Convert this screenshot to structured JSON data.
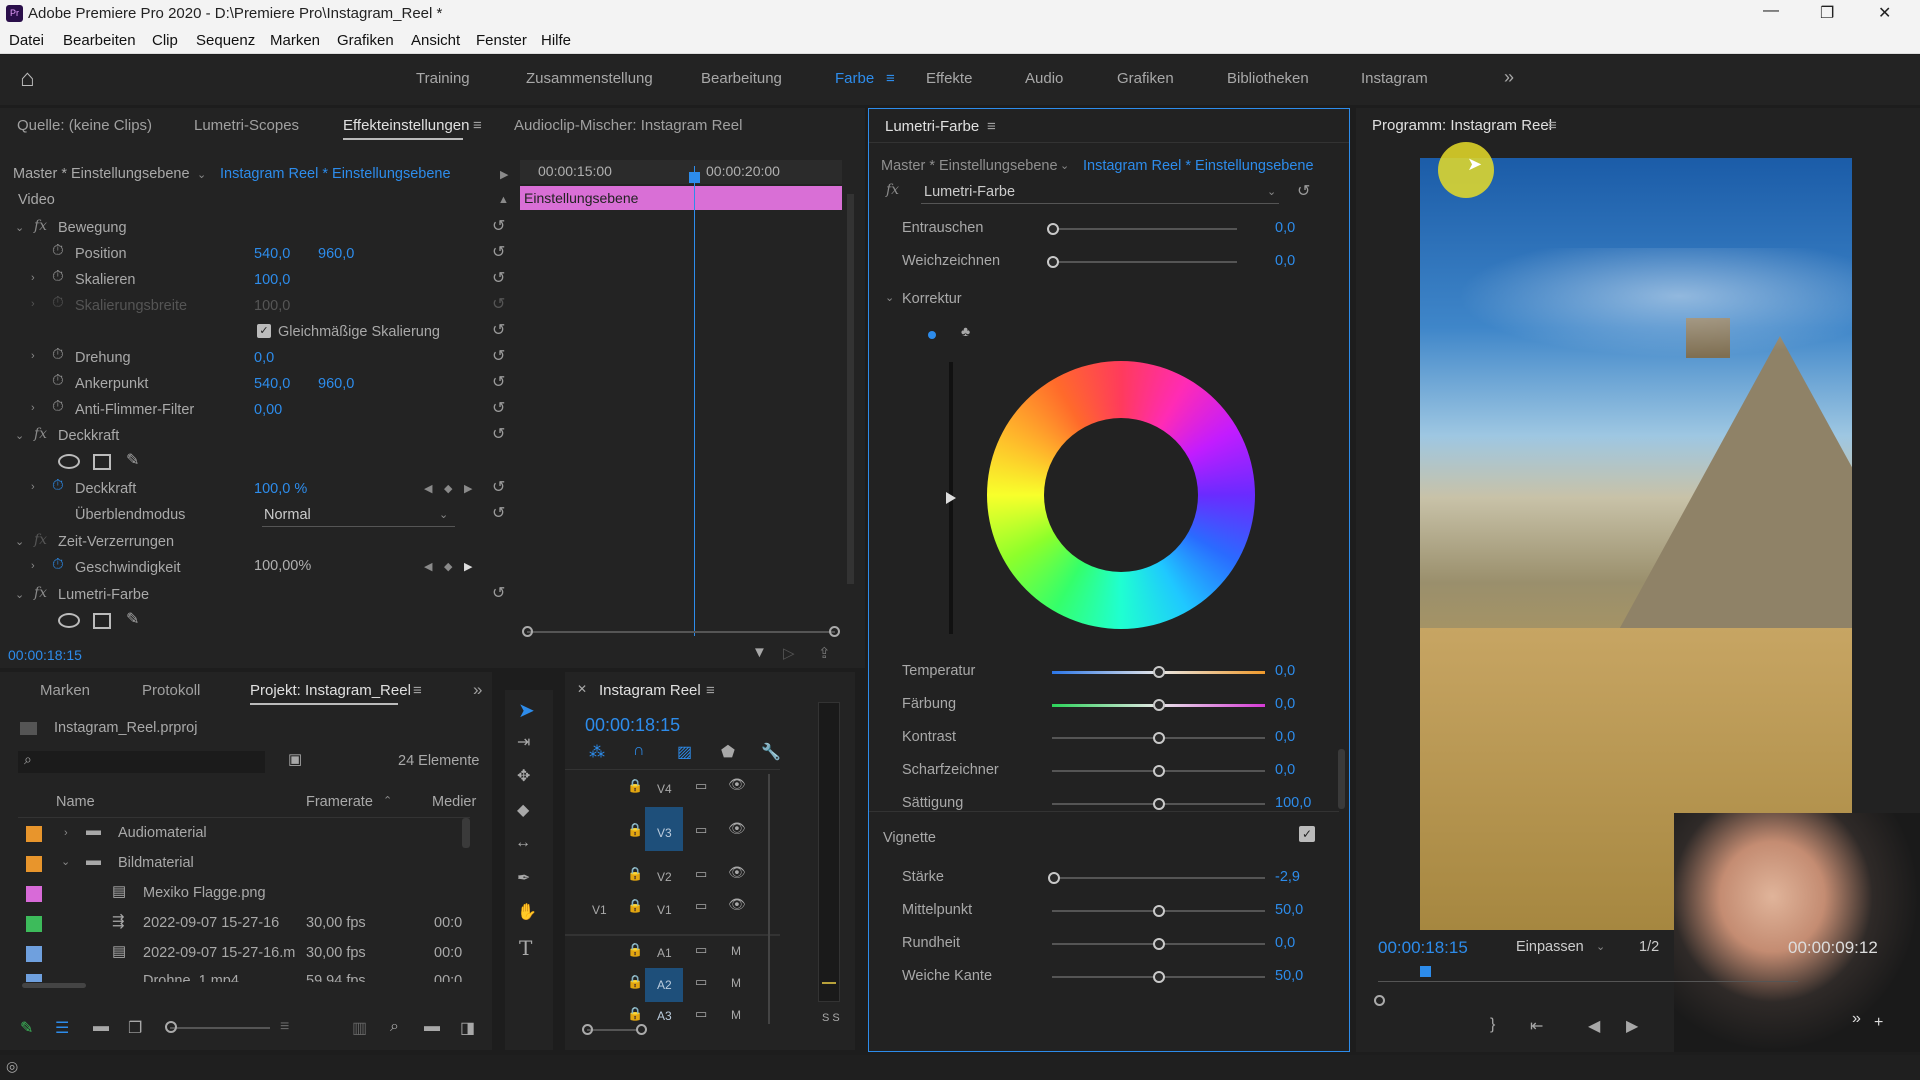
{
  "window": {
    "title": "Adobe Premiere Pro 2020 - D:\\Premiere Pro\\Instagram_Reel *",
    "minimize": "—",
    "maximize": "❐",
    "close": "✕"
  },
  "menu": [
    "Datei",
    "Bearbeiten",
    "Clip",
    "Sequenz",
    "Marken",
    "Grafiken",
    "Ansicht",
    "Fenster",
    "Hilfe"
  ],
  "workspaces": {
    "items": [
      "Training",
      "Zusammenstellung",
      "Bearbeitung",
      "Farbe",
      "Effekte",
      "Audio",
      "Grafiken",
      "Bibliotheken",
      "Instagram"
    ],
    "active": "Farbe",
    "more": "»"
  },
  "left_top": {
    "tabs": [
      "Quelle: (keine Clips)",
      "Lumetri-Scopes",
      "Effekteinstellungen",
      "Audioclip-Mischer: Instagram Reel"
    ],
    "master": "Master * Einstellungsebene",
    "clip": "Instagram Reel * Einstellungsebene",
    "ruler": [
      "00:00:15:00",
      "00:00:20:00"
    ],
    "clip_bar": "Einstellungsebene",
    "section_video": "Video",
    "motion": "Bewegung",
    "position": {
      "label": "Position",
      "x": "540,0",
      "y": "960,0"
    },
    "scale": {
      "label": "Skalieren",
      "value": "100,0"
    },
    "scale_width": {
      "label": "Skalierungsbreite",
      "value": "100,0"
    },
    "uniform": "Gleichmäßige Skalierung",
    "rotation": {
      "label": "Drehung",
      "value": "0,0"
    },
    "anchor": {
      "label": "Ankerpunkt",
      "x": "540,0",
      "y": "960,0"
    },
    "flicker": {
      "label": "Anti-Flimmer-Filter",
      "value": "0,00"
    },
    "opacity_group": "Deckkraft",
    "opacity": {
      "label": "Deckkraft",
      "value": "100,0 %"
    },
    "blend": {
      "label": "Überblendmodus",
      "value": "Normal"
    },
    "time_remap": "Zeit-Verzerrungen",
    "speed": {
      "label": "Geschwindigkeit",
      "value": "100,00%"
    },
    "lumetri": "Lumetri-Farbe",
    "timecode": "00:00:18:15"
  },
  "project": {
    "tabs": [
      "Marken",
      "Protokoll",
      "Projekt: Instagram_Reel"
    ],
    "file": "Instagram_Reel.prproj",
    "count": "24 Elemente",
    "columns": [
      "Name",
      "Framerate",
      "Medier"
    ],
    "rows": [
      {
        "name": "Audiomaterial",
        "fps": "",
        "media": "",
        "color": "#e8952c",
        "type": "folder"
      },
      {
        "name": "Bildmaterial",
        "fps": "",
        "media": "",
        "color": "#e8952c",
        "type": "folder"
      },
      {
        "name": "Mexiko Flagge.png",
        "fps": "",
        "media": "",
        "color": "#d86ad8",
        "type": "image"
      },
      {
        "name": "2022-09-07 15-27-16",
        "fps": "30,00 fps",
        "media": "00:0",
        "color": "#3dbb5b",
        "type": "sequence"
      },
      {
        "name": "2022-09-07 15-27-16.m",
        "fps": "30,00 fps",
        "media": "00:0",
        "color": "#6fa0de",
        "type": "file"
      },
      {
        "name": "Drohne_1.mp4",
        "fps": "59,94 fps",
        "media": "00:0",
        "color": "#6fa0de",
        "type": "file"
      }
    ]
  },
  "timeline": {
    "title": "Instagram Reel",
    "timecode": "00:00:18:15",
    "video_tracks": [
      "V4",
      "V3",
      "V2",
      "V1"
    ],
    "audio_tracks": [
      "A1",
      "A2",
      "A3"
    ],
    "src_patch": "V1",
    "meter": "S S"
  },
  "lumetri": {
    "title": "Lumetri-Farbe",
    "master": "Master * Einstellungsebene",
    "clip": "Instagram Reel * Einstellungsebene",
    "effect": "Lumetri-Farbe",
    "denoise": {
      "label": "Entrauschen",
      "value": "0,0",
      "pos": 0
    },
    "blur": {
      "label": "Weichzeichnen",
      "value": "0,0",
      "pos": 0
    },
    "correction": "Korrektur",
    "sliders": [
      {
        "label": "Temperatur",
        "value": "0,0",
        "pos": 0.5
      },
      {
        "label": "Färbung",
        "value": "0,0",
        "pos": 0.5
      },
      {
        "label": "Kontrast",
        "value": "0,0",
        "pos": 0.5
      },
      {
        "label": "Scharfzeichner",
        "value": "0,0",
        "pos": 0.5
      },
      {
        "label": "Sättigung",
        "value": "100,0",
        "pos": 0.5
      }
    ],
    "vignette": "Vignette",
    "vig_sliders": [
      {
        "label": "Stärke",
        "value": "-2,9",
        "pos": 0.01
      },
      {
        "label": "Mittelpunkt",
        "value": "50,0",
        "pos": 0.5
      },
      {
        "label": "Rundheit",
        "value": "0,0",
        "pos": 0.5
      },
      {
        "label": "Weiche Kante",
        "value": "50,0",
        "pos": 0.5
      }
    ]
  },
  "program": {
    "title": "Programm: Instagram Reel",
    "timecode": "00:00:18:15",
    "fit": "Einpassen",
    "page": "1/2",
    "duration": "00:00:09:12"
  },
  "colors": {
    "accent": "#2d8ceb",
    "clip": "#d96fd6",
    "panel": "#232323"
  }
}
